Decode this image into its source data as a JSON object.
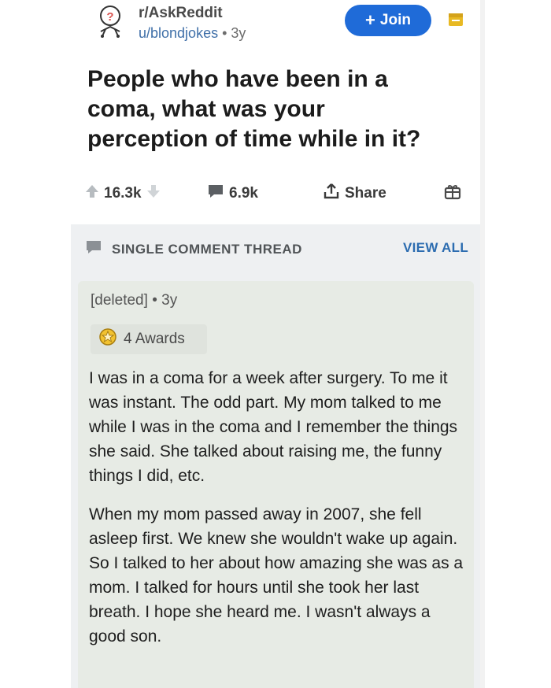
{
  "post": {
    "subreddit": "r/AskReddit",
    "author": "u/blondjokes",
    "separator": "•",
    "age": "3y",
    "join_label": "Join",
    "join_plus": "+",
    "title": "People who have been in a coma, what was your perception of time while in it?"
  },
  "actions": {
    "votes": "16.3k",
    "comments": "6.9k",
    "share": "Share"
  },
  "thread": {
    "label": "SINGLE COMMENT THREAD",
    "view_all": "VIEW ALL"
  },
  "comment": {
    "author": "[deleted]",
    "separator": "•",
    "age": "3y",
    "awards": "4 Awards",
    "paragraphs": [
      "I was in a coma for a week after surgery. To me it was instant.  The odd part.  My mom talked to me while I was in the coma and I remember the things she said.  She talked about raising me, the funny things I did, etc.",
      "When my mom passed away in 2007, she fell asleep first.  We knew she wouldn't wake up again.  So I talked to her about how amazing she was as a mom.  I talked for hours until she took her last breath.  I hope she heard me. I wasn't always a good son."
    ]
  },
  "colors": {
    "join_button": "#1f6bd8",
    "link_blue": "#2c6cb0",
    "comment_bg": "#e7ebe5",
    "thread_bg": "#eef0f2",
    "save_icon": "#e8b923"
  },
  "icons": [
    "subreddit-avatar-icon",
    "save-icon",
    "upvote-icon",
    "downvote-icon",
    "comment-icon",
    "share-icon",
    "gift-award-icon",
    "thread-icon",
    "award-icon"
  ]
}
